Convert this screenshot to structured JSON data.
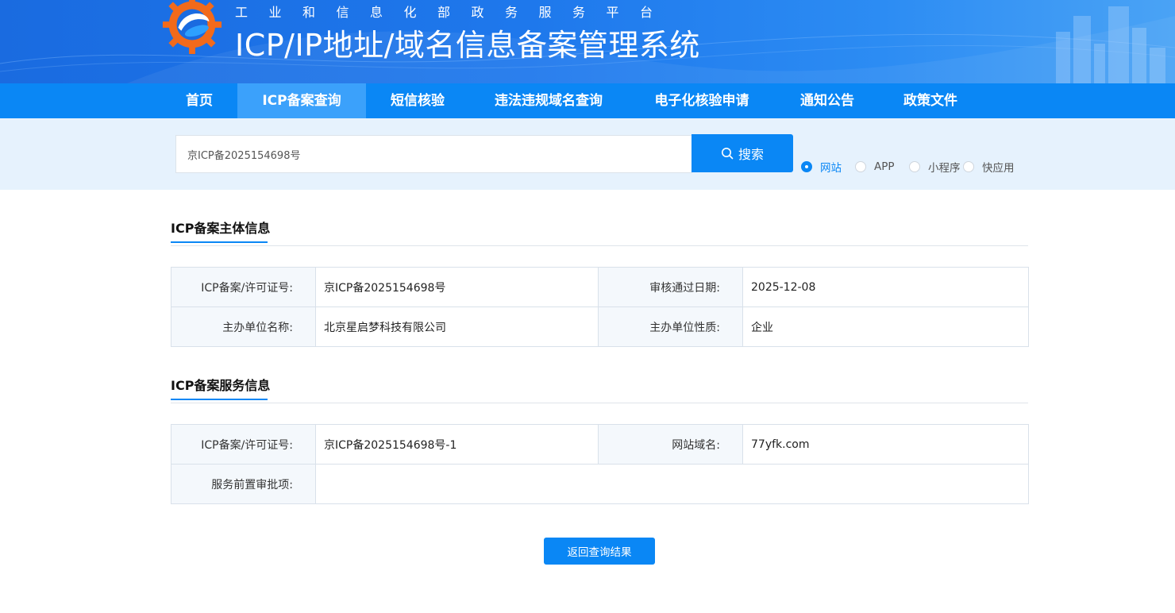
{
  "header": {
    "subtitle": "工业和信息化部政务服务平台",
    "title": "ICP/IP地址/域名信息备案管理系统"
  },
  "nav": {
    "items": [
      {
        "label": "首页"
      },
      {
        "label": "ICP备案查询",
        "active": true
      },
      {
        "label": "短信核验"
      },
      {
        "label": "违法违规域名查询"
      },
      {
        "label": "电子化核验申请"
      },
      {
        "label": "通知公告"
      },
      {
        "label": "政策文件"
      }
    ]
  },
  "search": {
    "value": "京ICP备2025154698号",
    "button_label": "搜索",
    "options": [
      {
        "label": "网站",
        "checked": true
      },
      {
        "label": "APP",
        "checked": false
      },
      {
        "label": "小程序",
        "checked": false
      },
      {
        "label": "快应用",
        "checked": false
      }
    ]
  },
  "subject_info": {
    "title": "ICP备案主体信息",
    "rows": [
      [
        "ICP备案/许可证号:",
        "京ICP备2025154698号",
        "审核通过日期:",
        "2025-12-08"
      ],
      [
        "主办单位名称:",
        "北京星启梦科技有限公司",
        "主办单位性质:",
        "企业"
      ]
    ]
  },
  "service_info": {
    "title": "ICP备案服务信息",
    "license_label": "ICP备案/许可证号:",
    "license_value": "京ICP备2025154698号-1",
    "domain_label": "网站域名:",
    "domain_value": "77yfk.com",
    "approval_label": "服务前置审批项:",
    "approval_value": ""
  },
  "back_button": "返回查询结果",
  "colors": {
    "primary": "#0a87f5",
    "nav_active": "#3ba1fb",
    "search_band": "#e6f2fd",
    "label_cell_bg": "#f4f8fc"
  }
}
